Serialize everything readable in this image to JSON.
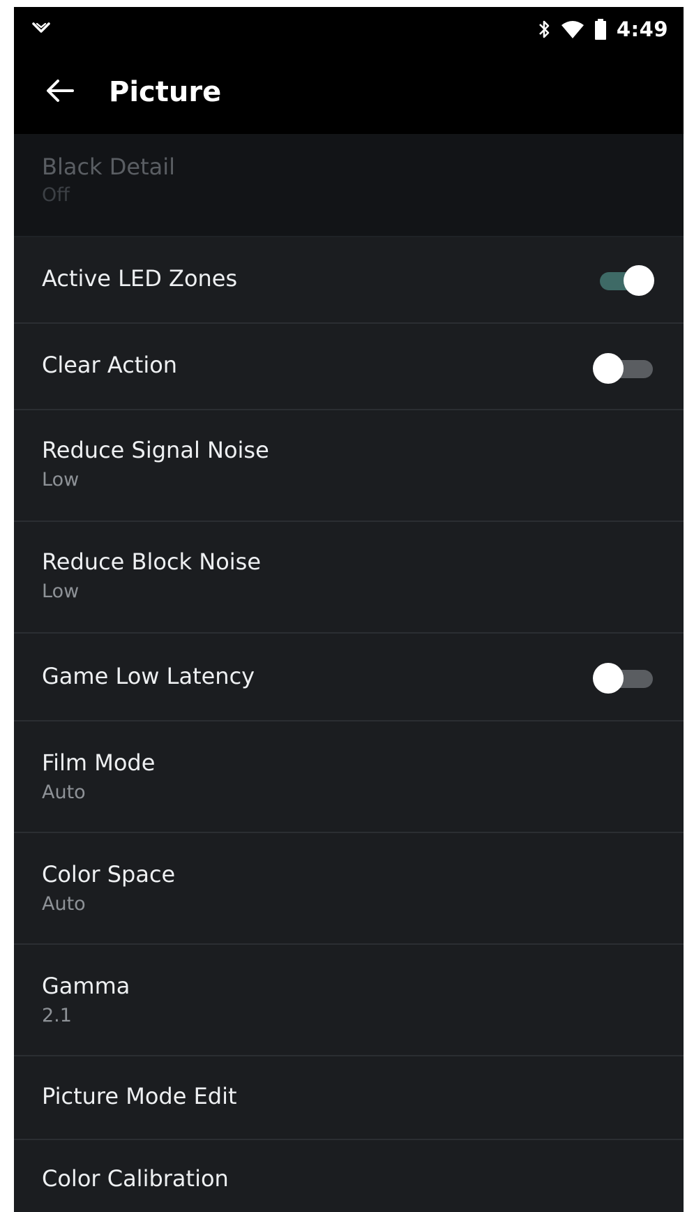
{
  "status_bar": {
    "left_icon": "vizio-v-logo-icon",
    "icons": [
      "bluetooth-icon",
      "wifi-icon",
      "battery-icon"
    ],
    "time": "4:49"
  },
  "header": {
    "back_icon": "arrow-left-icon",
    "title": "Picture"
  },
  "settings": [
    {
      "title": "Black Detail",
      "value": "Off",
      "faded": true
    },
    {
      "title": "Active LED Zones",
      "toggle": true
    },
    {
      "title": "Clear Action",
      "toggle": false
    },
    {
      "title": "Reduce Signal Noise",
      "value": "Low"
    },
    {
      "title": "Reduce Block Noise",
      "value": "Low"
    },
    {
      "title": "Game Low Latency",
      "toggle": false
    },
    {
      "title": "Film Mode",
      "value": "Auto"
    },
    {
      "title": "Color Space",
      "value": "Auto"
    },
    {
      "title": "Gamma",
      "value": "2.1"
    },
    {
      "title": "Picture Mode Edit"
    },
    {
      "title": "Color Calibration"
    }
  ],
  "colors": {
    "background": "#1b1d20",
    "bar": "#000000",
    "toggle_on_track": "#3e6a66",
    "toggle_off_track": "#5a5d61"
  }
}
